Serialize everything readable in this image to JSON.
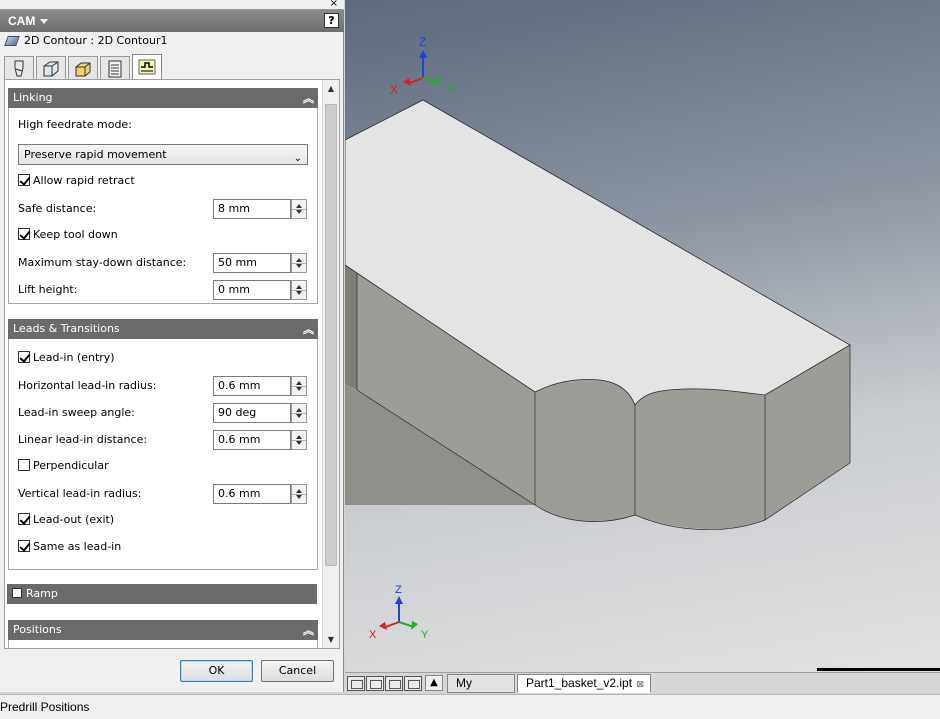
{
  "panel": {
    "title": "CAM",
    "help_label": "?",
    "close_label": "×",
    "operation": "2D Contour : 2D Contour1",
    "tabs": [
      "tool-tab",
      "geometry-tab",
      "heights-tab",
      "passes-tab",
      "linking-tab"
    ],
    "active_tab": "linking-tab"
  },
  "linking": {
    "header": "Linking",
    "feedrate_label": "High feedrate mode:",
    "feedrate_value": "Preserve rapid movement",
    "allow_rapid_retract": "Allow rapid retract",
    "safe_distance_label": "Safe distance:",
    "safe_distance_value": "8 mm",
    "keep_tool_down": "Keep tool down",
    "max_staydown_label": "Maximum stay-down distance:",
    "max_staydown_value": "50 mm",
    "lift_height_label": "Lift height:",
    "lift_height_value": "0 mm"
  },
  "leads": {
    "header": "Leads & Transitions",
    "lead_in": "Lead-in (entry)",
    "horiz_radius_label": "Horizontal lead-in radius:",
    "horiz_radius_value": "0.6 mm",
    "sweep_angle_label": "Lead-in sweep angle:",
    "sweep_angle_value": "90 deg",
    "linear_distance_label": "Linear lead-in distance:",
    "linear_distance_value": "0.6 mm",
    "perpendicular": "Perpendicular",
    "vertical_radius_label": "Vertical lead-in radius:",
    "vertical_radius_value": "0.6 mm",
    "lead_out": "Lead-out (exit)",
    "same_as_lead_in": "Same as lead-in"
  },
  "ramp": {
    "header": "Ramp"
  },
  "positions": {
    "header": "Positions"
  },
  "buttons": {
    "ok": "OK",
    "cancel": "Cancel"
  },
  "document_tabs": {
    "home": "My Home",
    "part": "Part1_basket_v2.ipt",
    "part_close": "⊠"
  },
  "axes": {
    "x": "X",
    "y": "Y",
    "z": "Z"
  },
  "status": {
    "text": "Predrill Positions"
  },
  "colors": {
    "header_bg": "#6b6b6b",
    "x_axis": "#e02020",
    "y_axis": "#20b020",
    "z_axis": "#2040e0",
    "model_top": "#e4e4e4",
    "model_side": "#9a9a94"
  }
}
